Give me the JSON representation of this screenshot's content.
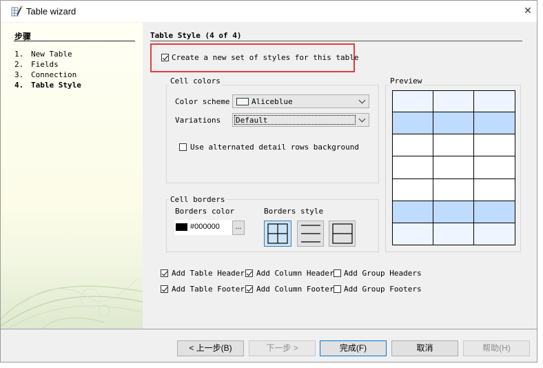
{
  "window": {
    "title": "Table wizard",
    "close_glyph": "✕"
  },
  "sidebar": {
    "heading": "步骤",
    "steps": [
      {
        "num": "1.",
        "label": "New Table"
      },
      {
        "num": "2.",
        "label": "Fields"
      },
      {
        "num": "3.",
        "label": "Connection"
      },
      {
        "num": "4.",
        "label": "Table Style"
      }
    ]
  },
  "page": {
    "title": "Table Style (4 of 4)",
    "create_styles_label": "Create a new set of styles for this table",
    "create_styles_checked": true
  },
  "cell_colors": {
    "group_label": "Cell colors",
    "scheme_label": "Color scheme",
    "scheme_value": "Aliceblue",
    "variations_label": "Variations",
    "variations_value": "Default",
    "alternated_label": "Use alternated detail rows background",
    "alternated_checked": false
  },
  "cell_borders": {
    "group_label": "Cell borders",
    "color_label": "Borders color",
    "color_value": "#000000",
    "browse_label": "...",
    "style_label": "Borders style"
  },
  "preview": {
    "label": "Preview",
    "row_colors": [
      "#eef5ff",
      "#bfdbfe",
      "#ffffff",
      "#ffffff",
      "#ffffff",
      "#bfdbfe",
      "#eef5ff"
    ]
  },
  "options": {
    "add_table_header": "Add Table Header",
    "add_column_header": "Add Column Header",
    "add_group_headers": "Add Group Headers",
    "add_table_footer": "Add Table Footer",
    "add_column_footer": "Add Column Footer",
    "add_group_footers": "Add Group Footers"
  },
  "buttons": {
    "back": "< 上一步(B)",
    "next": "下一步 >",
    "finish": "完成(F)",
    "cancel": "取消",
    "help": "帮助(H)"
  },
  "colors": {
    "highlight": "#e33b3b",
    "accent": "#0078d7"
  }
}
